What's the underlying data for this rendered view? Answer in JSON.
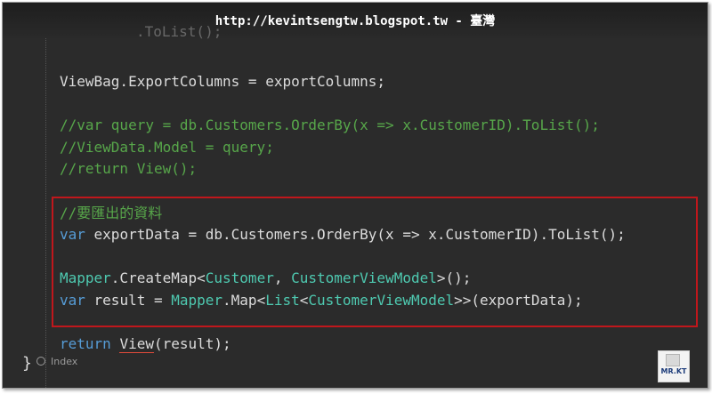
{
  "banner": {
    "text": "http://kevintsengtw.blogspot.tw - 臺灣"
  },
  "code": {
    "ghost_line": ".ToList();",
    "l1": {
      "a": "ViewBag.ExportColumns = exportColumns;"
    },
    "l2": {
      "a": "//var query = db.Customers.OrderBy(x => x.CustomerID).ToList();"
    },
    "l3": {
      "a": "//ViewData.Model = query;"
    },
    "l4": {
      "a": "//return View();"
    },
    "l5": {
      "a": "//要匯出的資料"
    },
    "l6": {
      "kw": "var",
      "rest": " exportData = db.Customers.OrderBy(x => x.CustomerID).ToList();"
    },
    "l7": {
      "t1": "Mapper",
      "p1": ".CreateMap<",
      "t2": "Customer",
      "p2": ", ",
      "t3": "CustomerViewModel",
      "p3": ">();"
    },
    "l8": {
      "kw": "var",
      "p1": " result = ",
      "t1": "Mapper",
      "p2": ".Map<",
      "t2": "List",
      "p3": "<",
      "t3": "CustomerViewModel",
      "p4": ">>(exportData);"
    },
    "l9": {
      "kw": "return",
      "p1": " ",
      "call": "View",
      "p2": "(result);"
    },
    "brace": "}"
  },
  "codelens": {
    "label": "Index"
  },
  "logo": {
    "text": "MR.KT"
  },
  "colors": {
    "background": "#2b2b2b",
    "comment": "#57a64a",
    "keyword": "#569cd6",
    "type": "#4ec9b0",
    "highlight_border": "#c0171c"
  }
}
